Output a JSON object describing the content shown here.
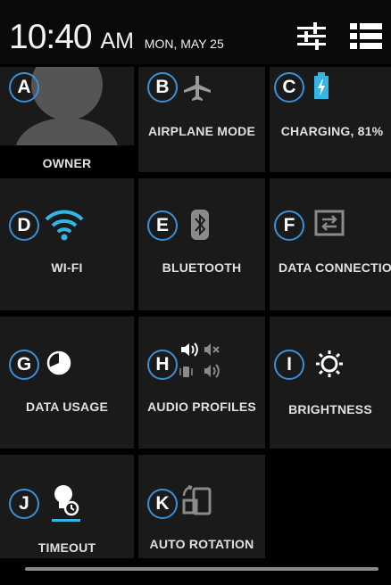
{
  "status_bar": {
    "time": "10:40",
    "ampm": "AM",
    "date": "MON, MAY 25"
  },
  "tiles": [
    {
      "badge": "A",
      "label": "OWNER",
      "icon": "avatar-icon"
    },
    {
      "badge": "B",
      "label": "AIRPLANE MODE",
      "icon": "airplane-icon"
    },
    {
      "badge": "C",
      "label": "CHARGING, 81%",
      "icon": "battery-charging-icon"
    },
    {
      "badge": "D",
      "label": "WI-FI",
      "icon": "wifi-icon"
    },
    {
      "badge": "E",
      "label": "BLUETOOTH",
      "icon": "bluetooth-icon"
    },
    {
      "badge": "F",
      "label": "DATA CONNECTION",
      "icon": "data-connection-icon"
    },
    {
      "badge": "G",
      "label": "DATA USAGE",
      "icon": "data-usage-icon"
    },
    {
      "badge": "H",
      "label": "AUDIO PROFILES",
      "icon": "audio-profiles-icon"
    },
    {
      "badge": "I",
      "label": "BRIGHTNESS",
      "icon": "brightness-icon"
    },
    {
      "badge": "J",
      "label": "TIMEOUT",
      "icon": "timeout-icon"
    },
    {
      "badge": "K",
      "label": "AUTO ROTATION",
      "icon": "auto-rotation-icon"
    }
  ],
  "colors": {
    "accent": "#33b5e5",
    "badge_ring": "#3b8fd6",
    "tile_bg": "#1a1a1a"
  }
}
